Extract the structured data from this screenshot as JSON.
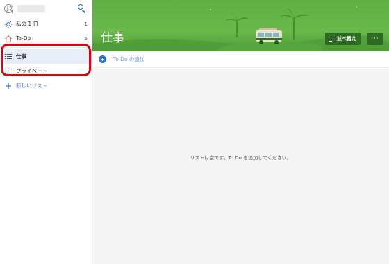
{
  "sidebar": {
    "items": [
      {
        "label": "私の 1 日",
        "count": "1",
        "icon": "sun-icon"
      },
      {
        "label": "To-Do",
        "count": "5",
        "icon": "home-icon"
      },
      {
        "label": "仕事",
        "count": "",
        "icon": "list-icon"
      },
      {
        "label": "プライベート",
        "count": "",
        "icon": "list-icon"
      }
    ],
    "new_list": "新しいリスト"
  },
  "main": {
    "title": "仕事",
    "sort_label": "並べ替え",
    "more_label": "···",
    "add_placeholder": "To Do の追加",
    "empty_message": "リストは空です。To Do を追加してください。"
  },
  "colors": {
    "accent": "#2f6dd1",
    "banner": "#5fae43",
    "highlight": "#e0000f",
    "button": "#2e6b22"
  }
}
